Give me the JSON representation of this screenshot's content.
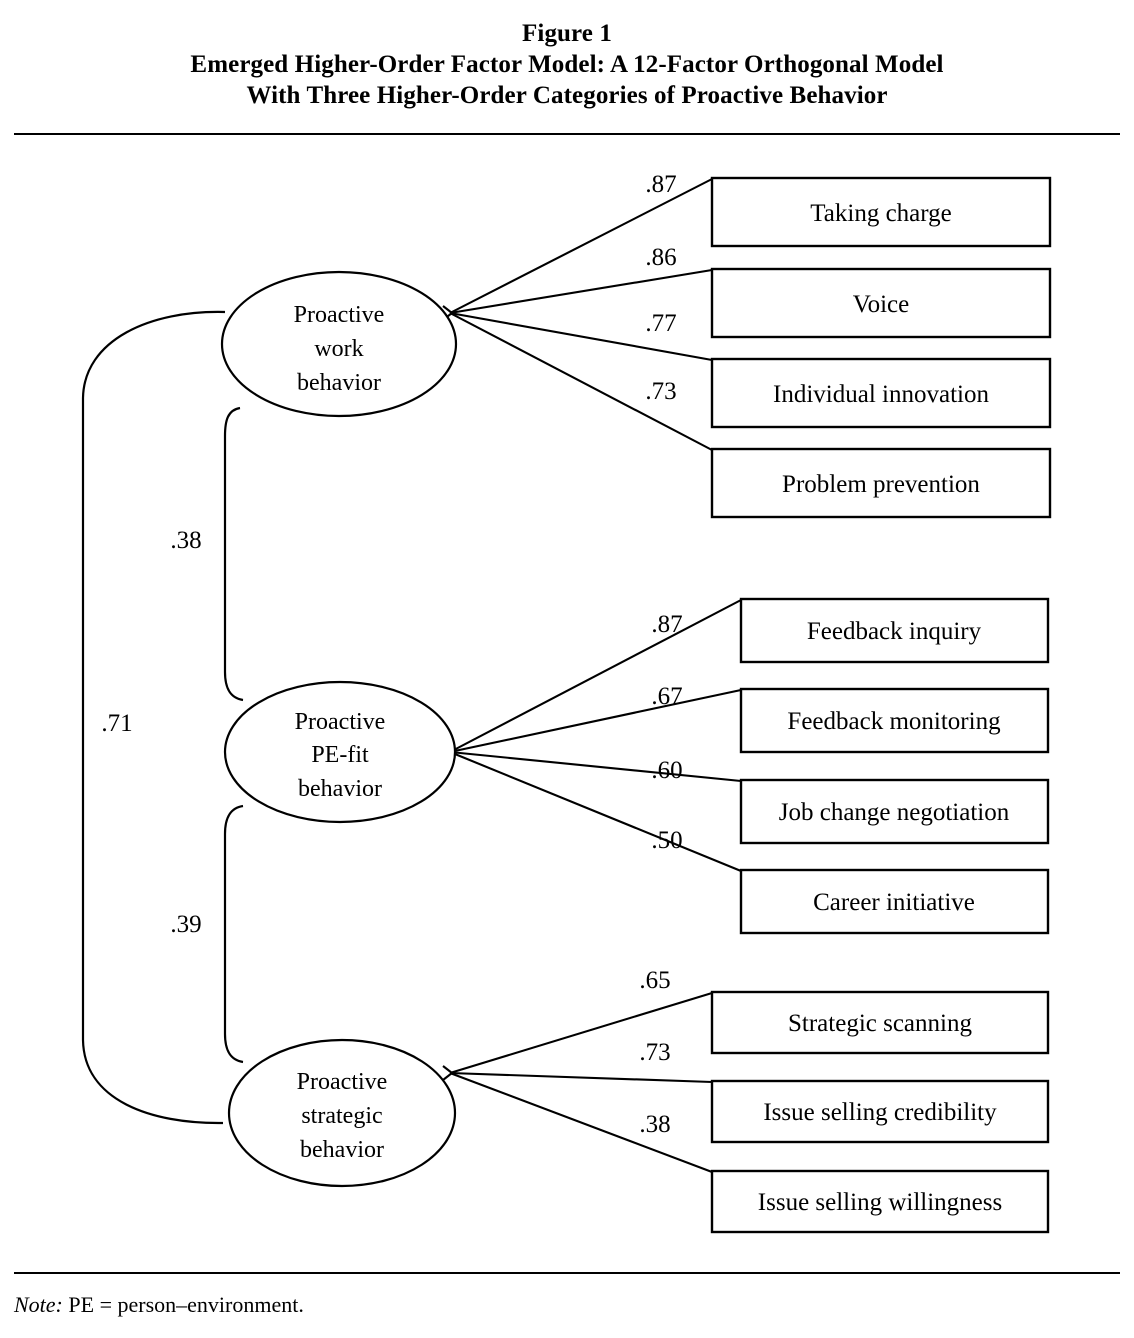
{
  "figure": {
    "title_lines": [
      "Figure 1",
      "Emerged Higher-Order Factor Model: A 12-Factor Orthogonal Model",
      "With Three Higher-Order Categories of Proactive Behavior"
    ],
    "note_label": "Note:",
    "note_text": " PE = person–environment."
  },
  "factors": [
    {
      "id": "proactive-work-behavior",
      "lines": [
        "Proactive",
        "work",
        "behavior"
      ],
      "indicators": [
        {
          "label": "Taking charge",
          "loading": ".87"
        },
        {
          "label": "Voice",
          "loading": ".86"
        },
        {
          "label": "Individual innovation",
          "loading": ".77"
        },
        {
          "label": "Problem prevention",
          "loading": ".73"
        }
      ]
    },
    {
      "id": "proactive-pe-fit-behavior",
      "lines": [
        "Proactive",
        "PE-fit",
        "behavior"
      ],
      "indicators": [
        {
          "label": "Feedback inquiry",
          "loading": ".87"
        },
        {
          "label": "Feedback monitoring",
          "loading": ".67"
        },
        {
          "label": "Job change negotiation",
          "loading": ".60"
        },
        {
          "label": "Career initiative",
          "loading": ".50"
        }
      ]
    },
    {
      "id": "proactive-strategic-behavior",
      "lines": [
        "Proactive",
        "strategic",
        "behavior"
      ],
      "indicators": [
        {
          "label": "Strategic scanning",
          "loading": ".65"
        },
        {
          "label": "Issue selling credibility",
          "loading": ".73"
        },
        {
          "label": "Issue selling willingness",
          "loading": ".38"
        }
      ]
    }
  ],
  "correlations": [
    {
      "id": "work-to-pefit",
      "value": ".38"
    },
    {
      "id": "work-to-strategic",
      "value": ".71"
    },
    {
      "id": "pefit-to-strategic",
      "value": ".39"
    }
  ],
  "chart_data": {
    "type": "diagram",
    "title": "Emerged Higher-Order Factor Model: A 12-Factor Orthogonal Model With Three Higher-Order Categories of Proactive Behavior",
    "nodes": {
      "latent": [
        "Proactive work behavior",
        "Proactive PE-fit behavior",
        "Proactive strategic behavior"
      ],
      "observed": [
        "Taking charge",
        "Voice",
        "Individual innovation",
        "Problem prevention",
        "Feedback inquiry",
        "Feedback monitoring",
        "Job change negotiation",
        "Career initiative",
        "Strategic scanning",
        "Issue selling credibility",
        "Issue selling willingness"
      ]
    },
    "loadings": [
      {
        "from": "Proactive work behavior",
        "to": "Taking charge",
        "value": 0.87
      },
      {
        "from": "Proactive work behavior",
        "to": "Voice",
        "value": 0.86
      },
      {
        "from": "Proactive work behavior",
        "to": "Individual innovation",
        "value": 0.77
      },
      {
        "from": "Proactive work behavior",
        "to": "Problem prevention",
        "value": 0.73
      },
      {
        "from": "Proactive PE-fit behavior",
        "to": "Feedback inquiry",
        "value": 0.87
      },
      {
        "from": "Proactive PE-fit behavior",
        "to": "Feedback monitoring",
        "value": 0.67
      },
      {
        "from": "Proactive PE-fit behavior",
        "to": "Job change negotiation",
        "value": 0.6
      },
      {
        "from": "Proactive PE-fit behavior",
        "to": "Career initiative",
        "value": 0.5
      },
      {
        "from": "Proactive strategic behavior",
        "to": "Strategic scanning",
        "value": 0.65
      },
      {
        "from": "Proactive strategic behavior",
        "to": "Issue selling credibility",
        "value": 0.73
      },
      {
        "from": "Proactive strategic behavior",
        "to": "Issue selling willingness",
        "value": 0.38
      }
    ],
    "factor_correlations": [
      {
        "between": [
          "Proactive work behavior",
          "Proactive PE-fit behavior"
        ],
        "value": 0.38
      },
      {
        "between": [
          "Proactive work behavior",
          "Proactive strategic behavior"
        ],
        "value": 0.71
      },
      {
        "between": [
          "Proactive PE-fit behavior",
          "Proactive strategic behavior"
        ],
        "value": 0.39
      }
    ]
  }
}
